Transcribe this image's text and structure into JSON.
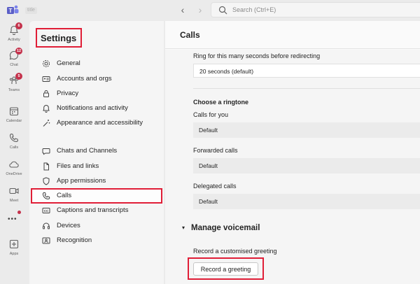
{
  "titlebar": {
    "chip": "title",
    "search_placeholder": "Search (Ctrl+E)"
  },
  "rail": {
    "activity": {
      "label": "Activity",
      "badge": "6"
    },
    "chat": {
      "label": "Chat",
      "badge": "12"
    },
    "teams": {
      "label": "Teams",
      "badge": "5"
    },
    "calendar": {
      "label": "Calendar"
    },
    "calls": {
      "label": "Calls"
    },
    "onedrive": {
      "label": "OneDrive"
    },
    "meet": {
      "label": "Meet"
    },
    "more": "•••",
    "apps": {
      "label": "Apps"
    }
  },
  "settings": {
    "title": "Settings",
    "items": [
      {
        "label": "General"
      },
      {
        "label": "Accounts and orgs"
      },
      {
        "label": "Privacy"
      },
      {
        "label": "Notifications and activity"
      },
      {
        "label": "Appearance and accessibility"
      },
      {
        "label": "Chats and Channels"
      },
      {
        "label": "Files and links"
      },
      {
        "label": "App permissions"
      },
      {
        "label": "Calls"
      },
      {
        "label": "Captions and transcripts"
      },
      {
        "label": "Devices"
      },
      {
        "label": "Recognition"
      }
    ]
  },
  "main": {
    "title": "Calls",
    "ring_label": "Ring for this many seconds before redirecting",
    "ring_value": "20 seconds (default)",
    "ringtone_heading": "Choose a ringtone",
    "calls_for_you_label": "Calls for you",
    "calls_for_you_value": "Default",
    "forwarded_label": "Forwarded calls",
    "forwarded_value": "Default",
    "delegated_label": "Delegated calls",
    "delegated_value": "Default",
    "voicemail_chevron": "▾",
    "voicemail_heading": "Manage voicemail",
    "greeting_label": "Record a customised greeting",
    "record_button": "Record a greeting"
  },
  "colors": {
    "highlight": "#e01e37",
    "badge": "#c4314b",
    "teams_purple": "#5b5fc7"
  }
}
